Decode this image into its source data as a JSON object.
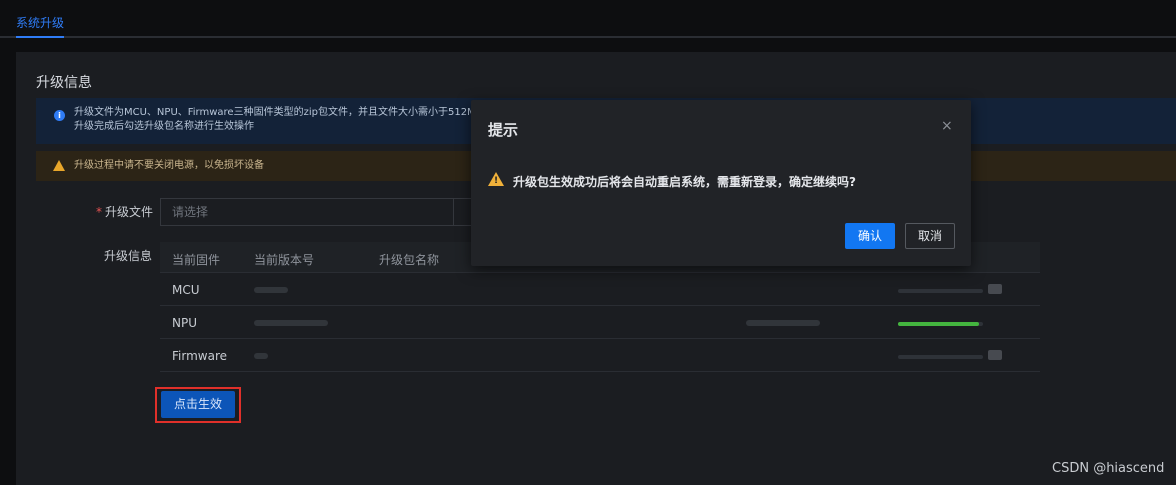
{
  "tabs": {
    "active_label": "系统升级"
  },
  "panel": {
    "title": "升级信息"
  },
  "alerts": {
    "info_line1": "升级文件为MCU、NPU、Firmware三种固件类型的zip包文件，并且文件大小需小于512M",
    "info_line2": "升级完成后勾选升级包名称进行生效操作",
    "warning": "升级过程中请不要关闭电源，以免损坏设备"
  },
  "form": {
    "required_mark": "*",
    "upload_label": "升级文件",
    "upload_placeholder": "请选择",
    "info_label": "升级信息"
  },
  "table": {
    "headers": [
      "当前固件",
      "当前版本号",
      "升级包名称"
    ],
    "rows": [
      {
        "firmware": "MCU",
        "progress": 0
      },
      {
        "firmware": "NPU",
        "progress": 0.95
      },
      {
        "firmware": "Firmware",
        "progress": 0
      }
    ]
  },
  "actions": {
    "apply_label": "点击生效"
  },
  "modal": {
    "title": "提示",
    "close_glyph": "×",
    "message": "升级包生效成功后将会自动重启系统，需重新登录，确定继续吗?",
    "confirm_label": "确认",
    "cancel_label": "取消"
  },
  "watermark": "CSDN @hiascend",
  "colors": {
    "accent": "#2f7cf6",
    "primary_button": "#1277f2",
    "warning": "#f0b13a",
    "highlight_border": "#e0302a",
    "progress": "#44b53f"
  }
}
